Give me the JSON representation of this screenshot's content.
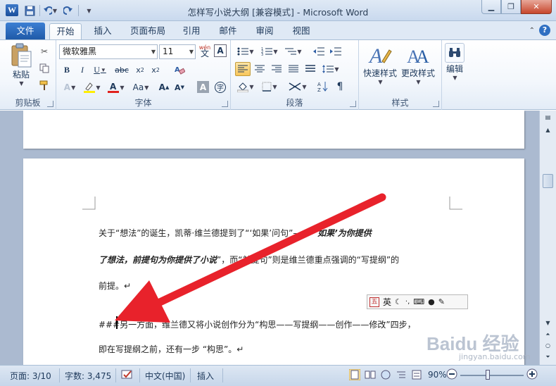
{
  "window": {
    "title": "怎样写小说大纲 [兼容模式] - Microsoft Word",
    "app_logo": "W"
  },
  "tabs": {
    "file": "文件",
    "items": [
      "开始",
      "插入",
      "页面布局",
      "引用",
      "邮件",
      "审阅",
      "视图"
    ],
    "active": "开始"
  },
  "ribbon": {
    "clipboard": {
      "label": "剪贴板",
      "paste": "粘贴"
    },
    "font": {
      "label": "字体",
      "font_name": "微软雅黑",
      "font_size": "11",
      "wen": "wén"
    },
    "paragraph": {
      "label": "段落"
    },
    "styles": {
      "label": "样式",
      "quick_styles": "快速样式",
      "change_styles": "更改样式"
    },
    "editing": {
      "label": "编辑",
      "button": "编辑"
    }
  },
  "document": {
    "line1a": "关于“想法”的诞生，凯蒂·维兰德提到了“‘如果’问句”——“",
    "line1b": "‘如果’为你提供",
    "line2a": "了想法，前提句为你提供了小说",
    "line2b": "”，而“前提句”则是维兰德重点强调的“写提纲”的",
    "line3": "前提。↵",
    "line4": "###另一方面，维兰德又将小说创作分为“构思——写提纲——创作——修改”四步，",
    "line5": "即在写提纲之前，还有一步 “构思”。↵"
  },
  "ime": {
    "mode": "英",
    "logo": "五"
  },
  "statusbar": {
    "page": "页面: 3/10",
    "words": "字数: 3,475",
    "language": "中文(中国)",
    "insert": "插入",
    "zoom": "90%"
  },
  "watermark": {
    "brand": "Baidu 经验",
    "url": "jingyan.baidu.com"
  },
  "colors": {
    "accent": "#2b6bc4",
    "annotation_arrow": "#e8222b",
    "ribbon_bg": "#f3f7fc"
  }
}
